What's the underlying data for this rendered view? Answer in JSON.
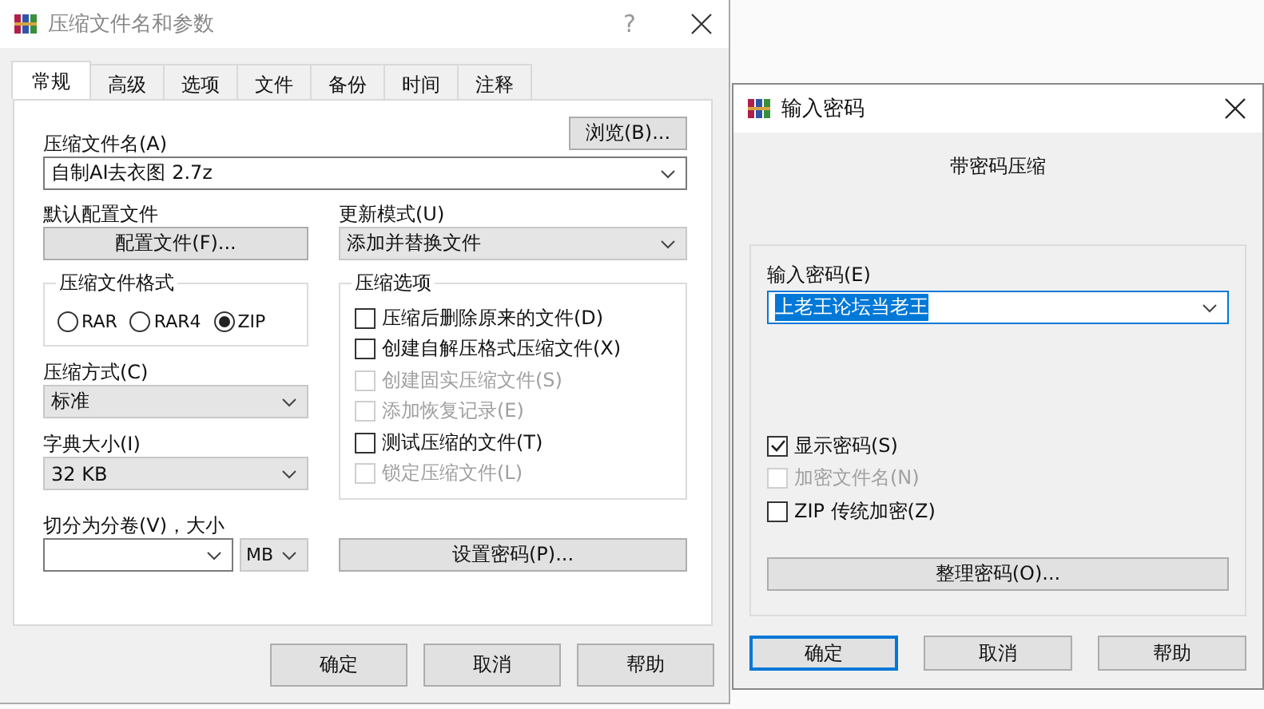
{
  "main_dialog": {
    "title": "压缩文件名和参数",
    "help_glyph": "?",
    "tabs": [
      {
        "label": "常规",
        "selected": true
      },
      {
        "label": "高级",
        "selected": false
      },
      {
        "label": "选项",
        "selected": false
      },
      {
        "label": "文件",
        "selected": false
      },
      {
        "label": "备份",
        "selected": false
      },
      {
        "label": "时间",
        "selected": false
      },
      {
        "label": "注释",
        "selected": false
      }
    ],
    "archive_name": {
      "label": "压缩文件名(A)",
      "value": "自制AI去衣图 2.7z"
    },
    "browse_button": "浏览(B)...",
    "profiles": {
      "label": "默认配置文件",
      "button": "配置文件(F)..."
    },
    "update_mode": {
      "label": "更新模式(U)",
      "value": "添加并替换文件"
    },
    "archive_format": {
      "label": "压缩文件格式",
      "options": [
        {
          "label": "RAR",
          "selected": false
        },
        {
          "label": "RAR4",
          "selected": false
        },
        {
          "label": "ZIP",
          "selected": true
        }
      ]
    },
    "compression_method": {
      "label": "压缩方式(C)",
      "value": "标准"
    },
    "dictionary_size": {
      "label": "字典大小(I)",
      "value": "32 KB"
    },
    "split_volumes": {
      "label": "切分为分卷(V)，大小",
      "unit": "MB"
    },
    "archiving_options": {
      "label": "压缩选项",
      "items": [
        {
          "label": "压缩后删除原来的文件(D)",
          "checked": false,
          "disabled": false
        },
        {
          "label": "创建自解压格式压缩文件(X)",
          "checked": false,
          "disabled": false
        },
        {
          "label": "创建固实压缩文件(S)",
          "checked": false,
          "disabled": true
        },
        {
          "label": "添加恢复记录(E)",
          "checked": false,
          "disabled": true
        },
        {
          "label": "测试压缩的文件(T)",
          "checked": false,
          "disabled": false
        },
        {
          "label": "锁定压缩文件(L)",
          "checked": false,
          "disabled": true
        }
      ]
    },
    "set_password_button": "设置密码(P)...",
    "buttons": [
      {
        "label": "确定",
        "focused": false
      },
      {
        "label": "取消",
        "focused": false
      },
      {
        "label": "帮助",
        "focused": false
      }
    ]
  },
  "password_dialog": {
    "title": "输入密码",
    "heading": "带密码压缩",
    "password": {
      "label": "输入密码(E)",
      "value": "上老王论坛当老王"
    },
    "options": [
      {
        "label": "显示密码(S)",
        "checked": true,
        "disabled": false
      },
      {
        "label": "加密文件名(N)",
        "checked": false,
        "disabled": true
      },
      {
        "label": "ZIP 传统加密(Z)",
        "checked": false,
        "disabled": false
      }
    ],
    "organize_button": "整理密码(O)...",
    "buttons": [
      {
        "label": "确定",
        "focused": true
      },
      {
        "label": "取消",
        "focused": false
      },
      {
        "label": "帮助",
        "focused": false
      }
    ]
  }
}
